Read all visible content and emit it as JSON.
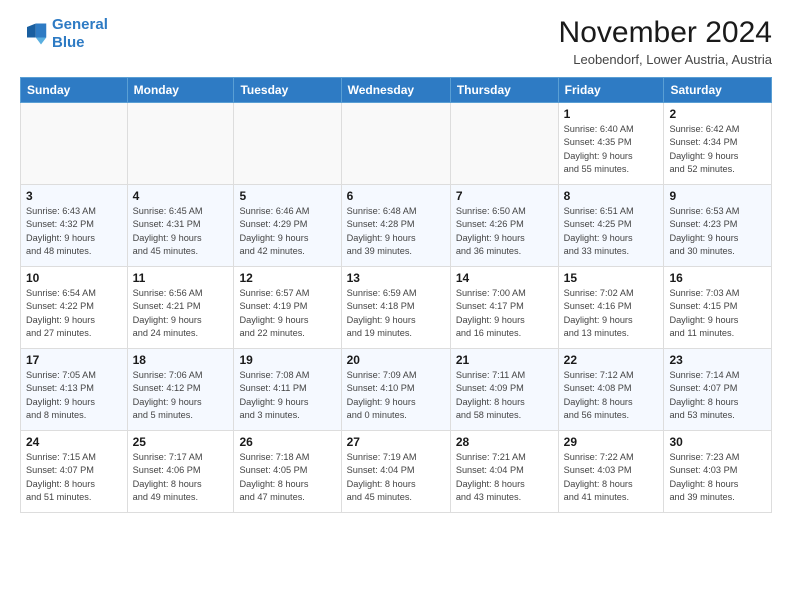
{
  "logo": {
    "line1": "General",
    "line2": "Blue"
  },
  "title": "November 2024",
  "subtitle": "Leobendorf, Lower Austria, Austria",
  "headers": [
    "Sunday",
    "Monday",
    "Tuesday",
    "Wednesday",
    "Thursday",
    "Friday",
    "Saturday"
  ],
  "weeks": [
    [
      {
        "day": "",
        "info": ""
      },
      {
        "day": "",
        "info": ""
      },
      {
        "day": "",
        "info": ""
      },
      {
        "day": "",
        "info": ""
      },
      {
        "day": "",
        "info": ""
      },
      {
        "day": "1",
        "info": "Sunrise: 6:40 AM\nSunset: 4:35 PM\nDaylight: 9 hours\nand 55 minutes."
      },
      {
        "day": "2",
        "info": "Sunrise: 6:42 AM\nSunset: 4:34 PM\nDaylight: 9 hours\nand 52 minutes."
      }
    ],
    [
      {
        "day": "3",
        "info": "Sunrise: 6:43 AM\nSunset: 4:32 PM\nDaylight: 9 hours\nand 48 minutes."
      },
      {
        "day": "4",
        "info": "Sunrise: 6:45 AM\nSunset: 4:31 PM\nDaylight: 9 hours\nand 45 minutes."
      },
      {
        "day": "5",
        "info": "Sunrise: 6:46 AM\nSunset: 4:29 PM\nDaylight: 9 hours\nand 42 minutes."
      },
      {
        "day": "6",
        "info": "Sunrise: 6:48 AM\nSunset: 4:28 PM\nDaylight: 9 hours\nand 39 minutes."
      },
      {
        "day": "7",
        "info": "Sunrise: 6:50 AM\nSunset: 4:26 PM\nDaylight: 9 hours\nand 36 minutes."
      },
      {
        "day": "8",
        "info": "Sunrise: 6:51 AM\nSunset: 4:25 PM\nDaylight: 9 hours\nand 33 minutes."
      },
      {
        "day": "9",
        "info": "Sunrise: 6:53 AM\nSunset: 4:23 PM\nDaylight: 9 hours\nand 30 minutes."
      }
    ],
    [
      {
        "day": "10",
        "info": "Sunrise: 6:54 AM\nSunset: 4:22 PM\nDaylight: 9 hours\nand 27 minutes."
      },
      {
        "day": "11",
        "info": "Sunrise: 6:56 AM\nSunset: 4:21 PM\nDaylight: 9 hours\nand 24 minutes."
      },
      {
        "day": "12",
        "info": "Sunrise: 6:57 AM\nSunset: 4:19 PM\nDaylight: 9 hours\nand 22 minutes."
      },
      {
        "day": "13",
        "info": "Sunrise: 6:59 AM\nSunset: 4:18 PM\nDaylight: 9 hours\nand 19 minutes."
      },
      {
        "day": "14",
        "info": "Sunrise: 7:00 AM\nSunset: 4:17 PM\nDaylight: 9 hours\nand 16 minutes."
      },
      {
        "day": "15",
        "info": "Sunrise: 7:02 AM\nSunset: 4:16 PM\nDaylight: 9 hours\nand 13 minutes."
      },
      {
        "day": "16",
        "info": "Sunrise: 7:03 AM\nSunset: 4:15 PM\nDaylight: 9 hours\nand 11 minutes."
      }
    ],
    [
      {
        "day": "17",
        "info": "Sunrise: 7:05 AM\nSunset: 4:13 PM\nDaylight: 9 hours\nand 8 minutes."
      },
      {
        "day": "18",
        "info": "Sunrise: 7:06 AM\nSunset: 4:12 PM\nDaylight: 9 hours\nand 5 minutes."
      },
      {
        "day": "19",
        "info": "Sunrise: 7:08 AM\nSunset: 4:11 PM\nDaylight: 9 hours\nand 3 minutes."
      },
      {
        "day": "20",
        "info": "Sunrise: 7:09 AM\nSunset: 4:10 PM\nDaylight: 9 hours\nand 0 minutes."
      },
      {
        "day": "21",
        "info": "Sunrise: 7:11 AM\nSunset: 4:09 PM\nDaylight: 8 hours\nand 58 minutes."
      },
      {
        "day": "22",
        "info": "Sunrise: 7:12 AM\nSunset: 4:08 PM\nDaylight: 8 hours\nand 56 minutes."
      },
      {
        "day": "23",
        "info": "Sunrise: 7:14 AM\nSunset: 4:07 PM\nDaylight: 8 hours\nand 53 minutes."
      }
    ],
    [
      {
        "day": "24",
        "info": "Sunrise: 7:15 AM\nSunset: 4:07 PM\nDaylight: 8 hours\nand 51 minutes."
      },
      {
        "day": "25",
        "info": "Sunrise: 7:17 AM\nSunset: 4:06 PM\nDaylight: 8 hours\nand 49 minutes."
      },
      {
        "day": "26",
        "info": "Sunrise: 7:18 AM\nSunset: 4:05 PM\nDaylight: 8 hours\nand 47 minutes."
      },
      {
        "day": "27",
        "info": "Sunrise: 7:19 AM\nSunset: 4:04 PM\nDaylight: 8 hours\nand 45 minutes."
      },
      {
        "day": "28",
        "info": "Sunrise: 7:21 AM\nSunset: 4:04 PM\nDaylight: 8 hours\nand 43 minutes."
      },
      {
        "day": "29",
        "info": "Sunrise: 7:22 AM\nSunset: 4:03 PM\nDaylight: 8 hours\nand 41 minutes."
      },
      {
        "day": "30",
        "info": "Sunrise: 7:23 AM\nSunset: 4:03 PM\nDaylight: 8 hours\nand 39 minutes."
      }
    ]
  ]
}
